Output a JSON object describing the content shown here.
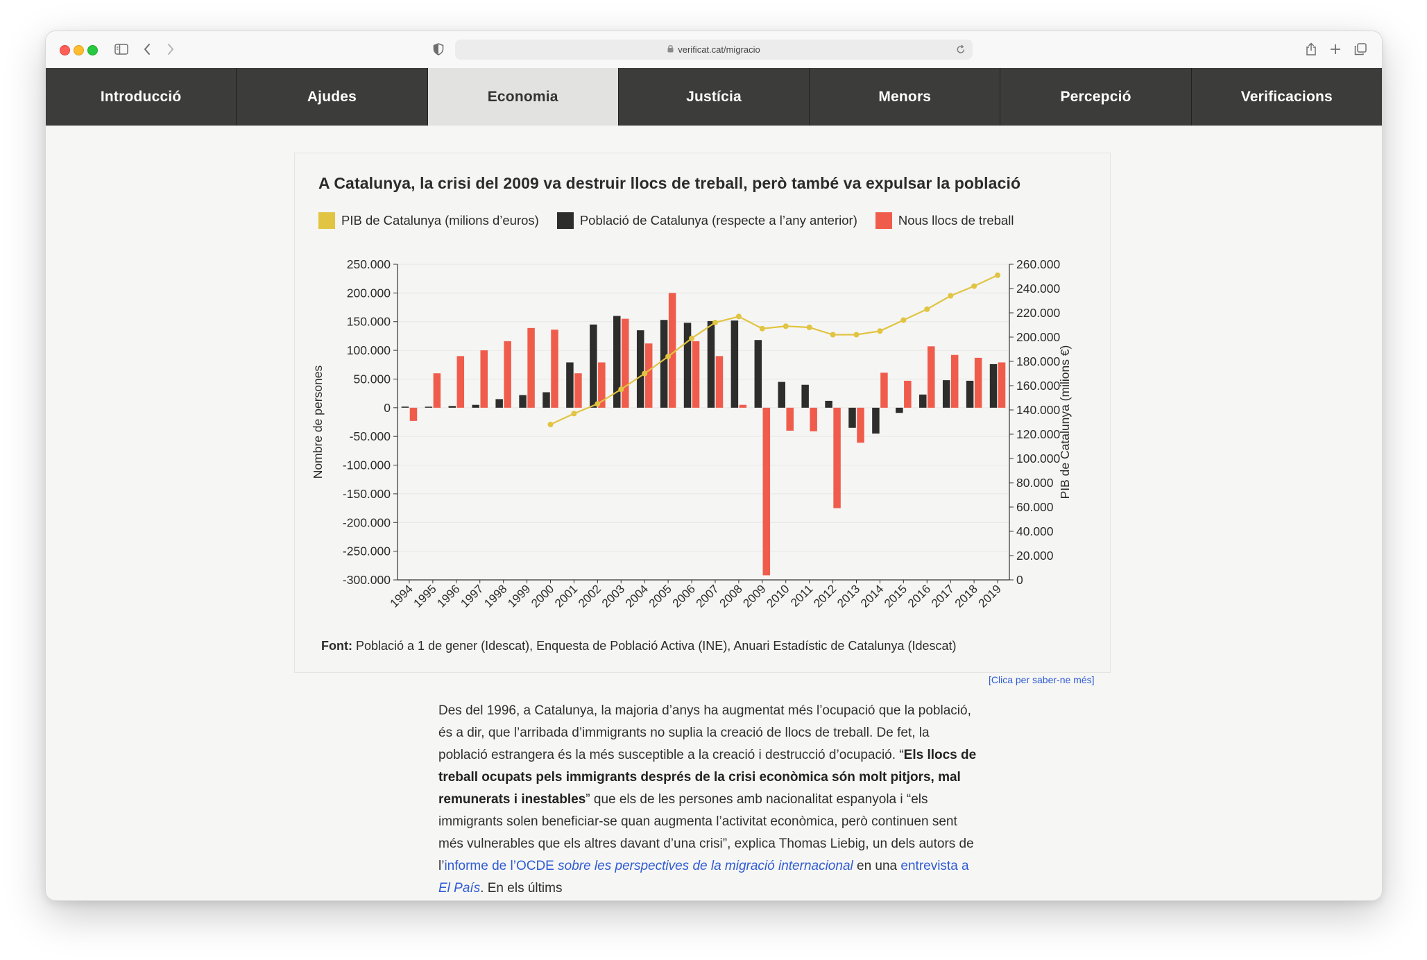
{
  "browser": {
    "url": "verificat.cat/migracio"
  },
  "nav": {
    "tabs": [
      {
        "label": "Introducció",
        "active": false
      },
      {
        "label": "Ajudes",
        "active": false
      },
      {
        "label": "Economia",
        "active": true
      },
      {
        "label": "Justícia",
        "active": false
      },
      {
        "label": "Menors",
        "active": false
      },
      {
        "label": "Percepció",
        "active": false
      },
      {
        "label": "Verificacions",
        "active": false
      }
    ]
  },
  "chart_data": {
    "type": "bar",
    "title": "A Catalunya, la crisi del 2009 va destruir llocs de treball, però també va expulsar la població",
    "categories": [
      "1994",
      "1995",
      "1996",
      "1997",
      "1998",
      "1999",
      "2000",
      "2001",
      "2002",
      "2003",
      "2004",
      "2005",
      "2006",
      "2007",
      "2008",
      "2009",
      "2010",
      "2011",
      "2012",
      "2013",
      "2014",
      "2015",
      "2016",
      "2017",
      "2018",
      "2019"
    ],
    "ylabel": "Nombre de persones",
    "ylim": [
      -300000,
      250000
    ],
    "yticks": [
      "250.000",
      "200.000",
      "150.000",
      "100.000",
      "50.000",
      "0",
      "-50.000",
      "-100.000",
      "-150.000",
      "-200.000",
      "-250.000",
      "-300.000"
    ],
    "y2label": "PIB de Catalunya (milions €)",
    "y2lim": [
      0,
      260000
    ],
    "y2ticks": [
      "260.000",
      "240.000",
      "220.000",
      "200.000",
      "180.000",
      "160.000",
      "140.000",
      "120.000",
      "100.000",
      "80.000",
      "60.000",
      "40.000",
      "20.000",
      "0"
    ],
    "series": [
      {
        "name": "PIB de Catalunya (milions d’euros)",
        "type": "line",
        "axis": "right",
        "color": "#e1c441",
        "values": [
          null,
          null,
          null,
          null,
          null,
          null,
          128000,
          137000,
          145000,
          157000,
          170000,
          184000,
          199000,
          212000,
          217000,
          207000,
          209000,
          208000,
          202000,
          202000,
          205000,
          214000,
          223000,
          234000,
          242000,
          251000
        ]
      },
      {
        "name": "Població de Catalunya (respecte a l’any anterior)",
        "type": "bar",
        "axis": "left",
        "color": "#2d2d2b",
        "values": [
          2000,
          1000,
          3000,
          5000,
          15000,
          22000,
          27000,
          79000,
          145000,
          160000,
          135000,
          153000,
          148000,
          151000,
          152000,
          118000,
          45000,
          40000,
          12000,
          -35000,
          -45000,
          -9000,
          23000,
          48000,
          47000,
          76000
        ]
      },
      {
        "name": "Nous llocs de treball",
        "type": "bar",
        "axis": "left",
        "color": "#f05c4b",
        "values": [
          -23000,
          60000,
          90000,
          100000,
          116000,
          139000,
          136000,
          60000,
          79000,
          155000,
          112000,
          200000,
          116000,
          90000,
          5000,
          -292000,
          -40000,
          -41000,
          -175000,
          -61000,
          61000,
          47000,
          107000,
          92000,
          87000,
          79000
        ]
      }
    ],
    "legend": "top",
    "grid": true
  },
  "source": {
    "label": "Font:",
    "text": "Població a 1 de gener (Idescat), Enquesta de Població Activa (INE), Anuari Estadístic de Catalunya (Idescat)"
  },
  "more_link": "[Clica per saber-ne més]",
  "article": {
    "t1": "Des del 1996, a Catalunya, la majoria d’anys ha augmentat més l’ocupació que la població, és a dir, que l’arribada d’immigrants no suplia la creació de llocs de treball. De fet, la població estrangera és la més susceptible a la creació i destrucció d’ocupació. “",
    "bold": "Els llocs de treball ocupats pels immigrants després de la crisi econòmica són molt pitjors, mal remunerats i inestables",
    "t2": "” que els de les persones amb nacionalitat espanyola i “els immigrants solen beneficiar-se quan augmenta l’activitat econòmica, però continuen sent més vulnerables que els altres davant d’una crisi”, explica Thomas Liebig, un dels autors de l’",
    "link1": "informe de l’OCDE ",
    "link1_italic": "sobre les perspectives de la migració internacional",
    "t3": " en una ",
    "link2": "entrevista a ",
    "link2_italic": "El País",
    "t4": ". En els últims"
  }
}
